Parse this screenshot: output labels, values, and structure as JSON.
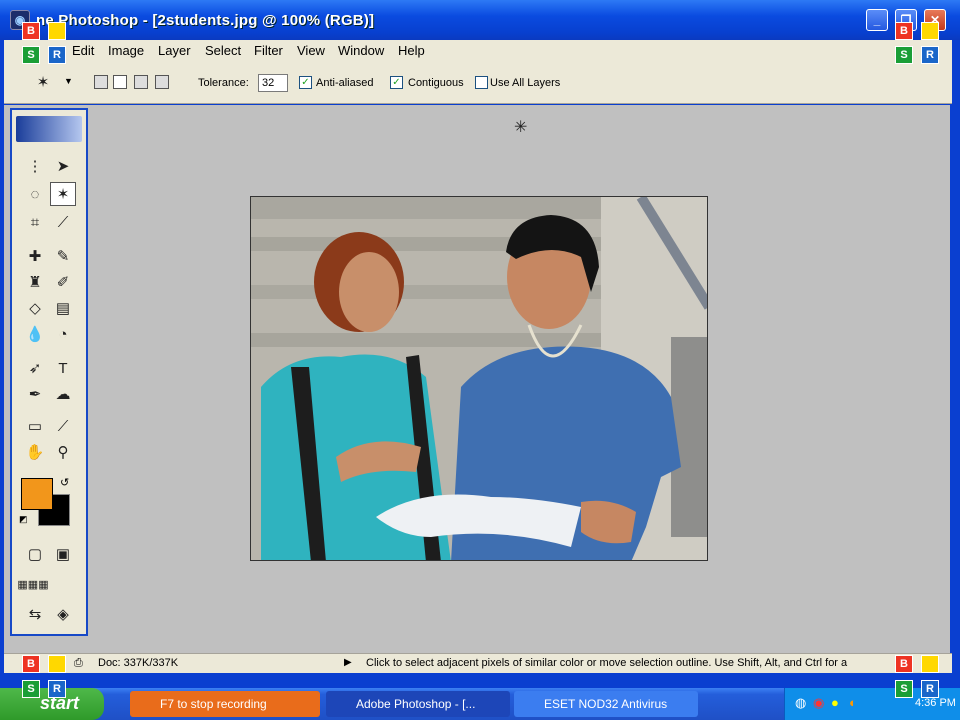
{
  "window": {
    "title": "Adobe Photoshop - [2students.jpg @ 100% (RGB)]",
    "title_visible": "ne Photoshop - [2students.jpg @ 100% (RGB)]"
  },
  "menu": [
    "Edit",
    "Image",
    "Layer",
    "Select",
    "Filter",
    "View",
    "Window",
    "Help"
  ],
  "options": {
    "tolerance_label": "Tolerance:",
    "tolerance_value": "32",
    "anti_aliased": "Anti-aliased",
    "contiguous": "Contiguous",
    "use_all_layers": "Use All Layers"
  },
  "status": {
    "doc": "Doc: 337K/337K",
    "hint": "Click to select adjacent pixels of similar color or move selection outline.  Use Shift, Alt, and Ctrl for a"
  },
  "taskbar": {
    "start": "start",
    "tasks": [
      {
        "label": "F7 to stop recording"
      },
      {
        "label": "Adobe Photoshop - [..."
      },
      {
        "label": "ESET NOD32 Antivirus"
      }
    ],
    "clock": "4:36 PM"
  },
  "overlay_buttons": [
    "B",
    "S",
    "R"
  ],
  "colors": {
    "foreground": "#f2961b",
    "background": "#000000"
  }
}
